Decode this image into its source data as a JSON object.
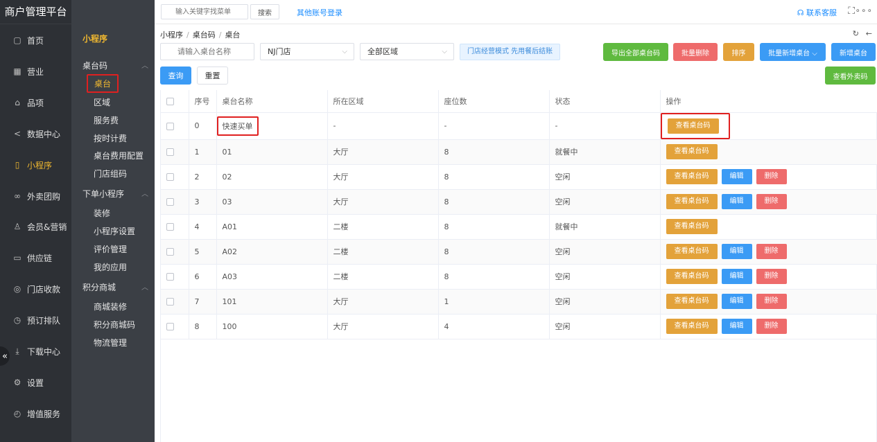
{
  "app": {
    "title": "商户管理平台"
  },
  "main_nav": [
    {
      "label": "首页",
      "icon": "home-icon",
      "glyph": "▢"
    },
    {
      "label": "营业",
      "icon": "calendar-icon",
      "glyph": "▦"
    },
    {
      "label": "品项",
      "icon": "bag-icon",
      "glyph": "⌂"
    },
    {
      "label": "数据中心",
      "icon": "share-icon",
      "glyph": "<"
    },
    {
      "label": "小程序",
      "icon": "phone-icon",
      "glyph": "▯"
    },
    {
      "label": "外卖团购",
      "icon": "bike-icon",
      "glyph": "∞"
    },
    {
      "label": "会员&营销",
      "icon": "user-icon",
      "glyph": "♙"
    },
    {
      "label": "供应链",
      "icon": "truck-icon",
      "glyph": "▭"
    },
    {
      "label": "门店收款",
      "icon": "coins-icon",
      "glyph": "◎"
    },
    {
      "label": "预订排队",
      "icon": "clock-icon",
      "glyph": "◷"
    },
    {
      "label": "下载中心",
      "icon": "download-icon",
      "glyph": "⤓"
    },
    {
      "label": "设置",
      "icon": "gear-icon",
      "glyph": "⚙"
    },
    {
      "label": "增值服务",
      "icon": "alarm-icon",
      "glyph": "◴"
    }
  ],
  "sub_nav": {
    "title": "小程序",
    "groups": [
      {
        "label": "桌台码",
        "items": [
          "桌台",
          "区域",
          "服务费",
          "按时计费",
          "桌台费用配置",
          "门店组码"
        ]
      },
      {
        "label": "下单小程序",
        "items": [
          "装修",
          "小程序设置",
          "评价管理",
          "我的应用"
        ]
      },
      {
        "label": "积分商城",
        "items": [
          "商城装修",
          "积分商城码",
          "物流管理"
        ]
      }
    ]
  },
  "topbar": {
    "menu_search_placeholder": "输入关键字找菜单",
    "search_label": "搜索",
    "other_login": "其他账号登录",
    "contact": "联系客服"
  },
  "breadcrumb": [
    "小程序",
    "桌台码",
    "桌台"
  ],
  "filters": {
    "name_placeholder": "请输入桌台名称",
    "store": "NJ门店",
    "area": "全部区域",
    "mode_tag": "门店经营模式 先用餐后结账"
  },
  "actions": {
    "export_all": "导出全部桌台码",
    "batch_delete": "批量删除",
    "sort": "排序",
    "batch_add": "批量新增桌台",
    "add": "新增桌台",
    "view_takeout": "查看外卖码",
    "query": "查询",
    "reset": "重置"
  },
  "table": {
    "headers": [
      "",
      "序号",
      "桌台名称",
      "所在区域",
      "座位数",
      "状态",
      "操作"
    ],
    "row_buttons": {
      "view_qr": "查看桌台码",
      "edit": "编辑",
      "delete": "删除"
    },
    "rows": [
      {
        "no": "0",
        "name": "快速买单",
        "area": "-",
        "seats": "-",
        "status": "-"
      },
      {
        "no": "1",
        "name": "01",
        "area": "大厅",
        "seats": "8",
        "status": "就餐中"
      },
      {
        "no": "2",
        "name": "02",
        "area": "大厅",
        "seats": "8",
        "status": "空闲"
      },
      {
        "no": "3",
        "name": "03",
        "area": "大厅",
        "seats": "8",
        "status": "空闲"
      },
      {
        "no": "4",
        "name": "A01",
        "area": "二楼",
        "seats": "8",
        "status": "就餐中"
      },
      {
        "no": "5",
        "name": "A02",
        "area": "二楼",
        "seats": "8",
        "status": "空闲"
      },
      {
        "no": "6",
        "name": "A03",
        "area": "二楼",
        "seats": "8",
        "status": "空闲"
      },
      {
        "no": "7",
        "name": "101",
        "area": "大厅",
        "seats": "1",
        "status": "空闲"
      },
      {
        "no": "8",
        "name": "100",
        "area": "大厅",
        "seats": "4",
        "status": "空闲"
      }
    ]
  }
}
